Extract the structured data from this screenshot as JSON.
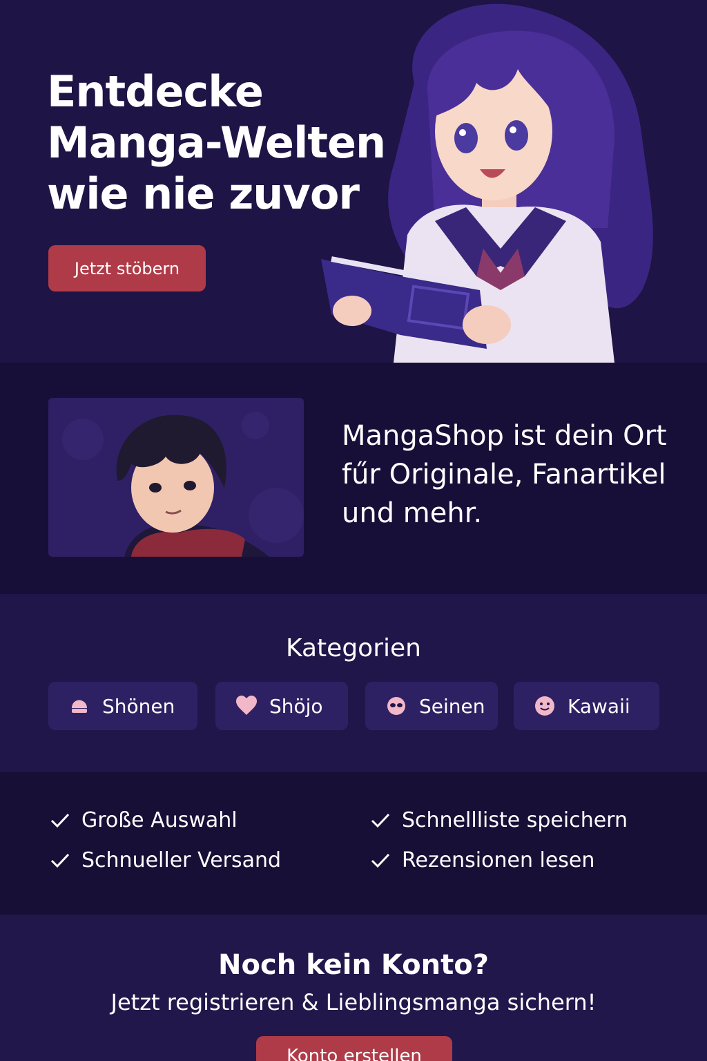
{
  "hero": {
    "title_line1": "Entdecke",
    "title_line2": "Manga-Welten",
    "title_line3": "wie nie zuvor",
    "button_label": "Jetzt stöbern"
  },
  "intro": {
    "text": "MangaShop ist dein Ort fűr Originale, Fanartikel und mehr."
  },
  "categories": {
    "title": "Kategorien",
    "items": [
      {
        "label": "Shönen",
        "icon": "hat-icon"
      },
      {
        "label": "Shöjo",
        "icon": "heart-icon"
      },
      {
        "label": "Seinen",
        "icon": "mask-icon"
      },
      {
        "label": "Kawaii",
        "icon": "smiley-icon"
      }
    ]
  },
  "features": {
    "items": [
      "Große Auswahl",
      "Schnellliste speichern",
      "Schnueller Versand",
      "Rezensionen lesen"
    ]
  },
  "cta": {
    "title": "Noch kein Konto?",
    "subtitle": "Jetzt registrieren & Lieblingsmanga  sichern!",
    "button_label": "Konto erstellen"
  },
  "colors": {
    "background": "#1d1442",
    "accent": "#b03b48",
    "pill": "#2e2163",
    "icon_pink": "#f2b7c9"
  }
}
